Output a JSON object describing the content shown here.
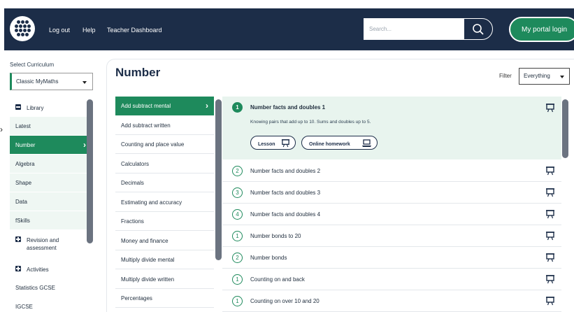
{
  "header": {
    "nav": [
      "Log out",
      "Help",
      "Teacher Dashboard"
    ],
    "search_placeholder": "Search...",
    "portal_label": "My portal login"
  },
  "sidebar": {
    "curriculum_label": "Select Curriculum",
    "curriculum_value": "Classic MyMaths",
    "items": [
      {
        "label": "Library",
        "icon": "menu-square-icon"
      },
      {
        "label": "Latest"
      },
      {
        "label": "Number",
        "active": true
      },
      {
        "label": "Algebra"
      },
      {
        "label": "Shape"
      },
      {
        "label": "Data"
      },
      {
        "label": "fSkills"
      },
      {
        "label": "Revision and assessment",
        "icon": "plus-square-icon"
      },
      {
        "label": "Activities",
        "icon": "plus-square-icon"
      },
      {
        "label": "Statistics GCSE"
      },
      {
        "label": "IGCSE"
      }
    ]
  },
  "main": {
    "title": "Number",
    "filter_label": "Filter",
    "filter_value": "Everything"
  },
  "topics": [
    "Add subtract mental",
    "Add subtract written",
    "Counting and place value",
    "Calculators",
    "Decimals",
    "Estimating and accuracy",
    "Fractions",
    "Money and finance",
    "Multiply divide mental",
    "Multiply divide written",
    "Percentages"
  ],
  "lessons": {
    "expanded": {
      "num": "1",
      "title": "Number facts and doubles 1",
      "description": "Knowing pairs that add up to 10. Sums and doubles up to 5.",
      "lesson_btn": "Lesson",
      "homework_btn": "Online homework"
    },
    "list": [
      {
        "num": "2",
        "title": "Number facts and doubles 2"
      },
      {
        "num": "3",
        "title": "Number facts and doubles 3"
      },
      {
        "num": "4",
        "title": "Number facts and doubles 4"
      },
      {
        "num": "1",
        "title": "Number bonds to 20"
      },
      {
        "num": "2",
        "title": "Number bonds"
      },
      {
        "num": "1",
        "title": "Counting on and back"
      },
      {
        "num": "1",
        "title": "Counting on over 10 and 20"
      }
    ]
  },
  "colors": {
    "header_bg": "#1c2d48",
    "accent_green": "#1e8a5c",
    "light_green": "#e8f4ee"
  }
}
